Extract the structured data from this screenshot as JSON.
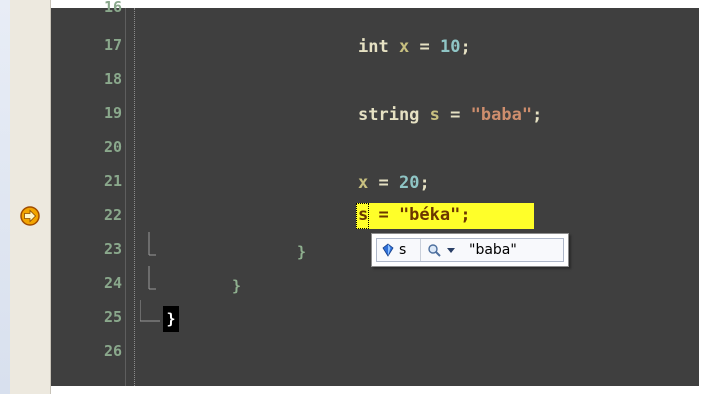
{
  "line_numbers": [
    "16",
    "17",
    "18",
    "19",
    "20",
    "21",
    "22",
    "23",
    "24",
    "25",
    "26"
  ],
  "code": {
    "l17_type": "int",
    "l17_var": "x",
    "l17_op": "=",
    "l17_value": "10",
    "l17_end": ";",
    "l19_type": "string",
    "l19_var": "s",
    "l19_op": "=",
    "l19_value": "\"baba\"",
    "l19_end": ";",
    "l21_var": "x",
    "l21_op": "=",
    "l21_value": "20",
    "l21_end": ";",
    "l22_stmt": "s = \"béka\";",
    "l23_brace": "}",
    "l24_brace": "}",
    "l25_brace": "}"
  },
  "datatip": {
    "variable": "s",
    "value": "\"baba\""
  },
  "colors": {
    "editor_background": "#3f3f3f",
    "current_statement_highlight": "#ffff29",
    "line_numbers": "#8aa88c"
  },
  "icons": {
    "execution_marker": "current-statement-arrow-icon",
    "variable": "field-icon",
    "visualizer": "magnifier-icon",
    "dropdown": "chevron-down-icon"
  }
}
